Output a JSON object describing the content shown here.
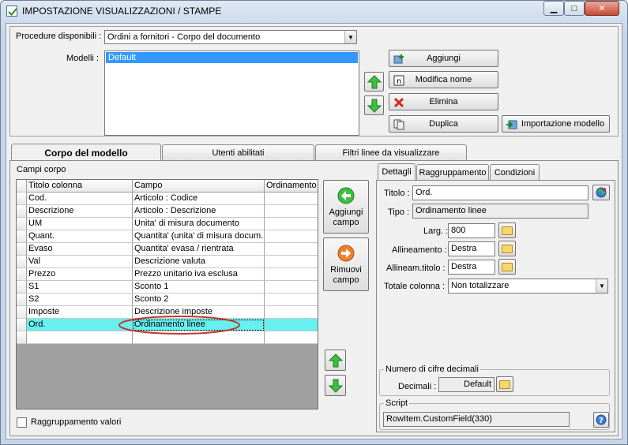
{
  "window": {
    "title": "IMPOSTAZIONE VISUALIZZAZIONI / STAMPE",
    "minimize": "▁",
    "maximize": "□",
    "close": "✕"
  },
  "top": {
    "procedure_label": "Procedure disponibili :",
    "procedure_value": "Ordini a fornitori - Corpo del documento",
    "models_label": "Modelli :",
    "models": [
      "Default"
    ],
    "buttons": {
      "add": "Aggiungi",
      "rename": "Modifica nome",
      "delete": "Elimina",
      "duplicate": "Duplica",
      "import": "Importazione modello"
    }
  },
  "tabs": [
    "Corpo del modello",
    "Utenti abilitati",
    "Filtri linee da visualizzare"
  ],
  "body": {
    "fields_label": "Campi corpo",
    "columns": [
      "Titolo colonna",
      "Campo",
      "Ordinamento"
    ],
    "rows": [
      {
        "title": "Cod.",
        "field": "Articolo : Codice",
        "order": ""
      },
      {
        "title": "Descrizione",
        "field": "Articolo : Descrizione",
        "order": ""
      },
      {
        "title": "UM",
        "field": "Unita' di misura documento",
        "order": ""
      },
      {
        "title": "Quant.",
        "field": "Quantita' (unita' di misura docum...",
        "order": ""
      },
      {
        "title": "Evaso",
        "field": "Quantita' evasa / rientrata",
        "order": ""
      },
      {
        "title": "Val",
        "field": "Descrizione valuta",
        "order": ""
      },
      {
        "title": "Prezzo",
        "field": "Prezzo unitario iva esclusa",
        "order": ""
      },
      {
        "title": "S1",
        "field": "Sconto 1",
        "order": ""
      },
      {
        "title": "S2",
        "field": "Sconto 2",
        "order": ""
      },
      {
        "title": "Imposte",
        "field": "Descrizione imposte",
        "order": ""
      },
      {
        "title": "Ord.",
        "field": "Ordinamento linee",
        "order": ""
      },
      {
        "title": "",
        "field": "",
        "order": ""
      }
    ],
    "add_field": "Aggiungi campo",
    "remove_field": "Rimuovi campo",
    "group_values": "Raggruppamento valori"
  },
  "details": {
    "tabs": [
      "Dettagli",
      "Raggruppamento",
      "Condizioni"
    ],
    "title_label": "Titolo :",
    "title_value": "Ord.",
    "type_label": "Tipo :",
    "type_value": "Ordinamento linee",
    "width_label": "Larg. :",
    "width_value": "800",
    "align_label": "Allineamento :",
    "align_value": "Destra",
    "align_title_label": "Allineam.titolo :",
    "align_title_value": "Destra",
    "total_label": "Totale colonna :",
    "total_value": "Non totalizzare",
    "decimals_group": "Numero di cifre decimali",
    "decimals_label": "Decimali :",
    "decimals_value": "Default",
    "script_group": "Script",
    "script_value": "RowItem.CustomField(330)"
  },
  "colors": {
    "selection": "#3399ff",
    "row_highlight": "#66f0f0",
    "annotation": "#c0392b"
  }
}
